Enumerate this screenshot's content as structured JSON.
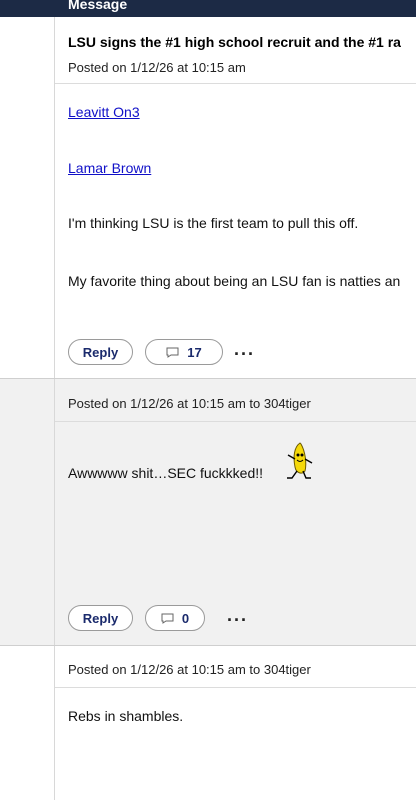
{
  "header": {
    "title": "Message"
  },
  "posts": [
    {
      "subject": "LSU signs the #1 high school recruit and the #1 ra",
      "meta": "Posted on 1/12/26 at 10:15 am",
      "links": [
        "Leavitt On3",
        "Lamar Brown"
      ],
      "paragraphs": [
        "I'm thinking LSU is the first team to pull this off.",
        "My favorite thing about being an LSU fan is natties an"
      ],
      "reply_label": "Reply",
      "comment_count": "17",
      "more_label": "..."
    },
    {
      "meta": "Posted on 1/12/26 at 10:15 am to 304tiger",
      "text": "Awwwww shit…SEC fuckkked!!",
      "reply_label": "Reply",
      "comment_count": "0",
      "more_label": "..."
    },
    {
      "meta": "Posted on 1/12/26 at 10:15 am to 304tiger",
      "text": "Rebs in shambles."
    }
  ]
}
